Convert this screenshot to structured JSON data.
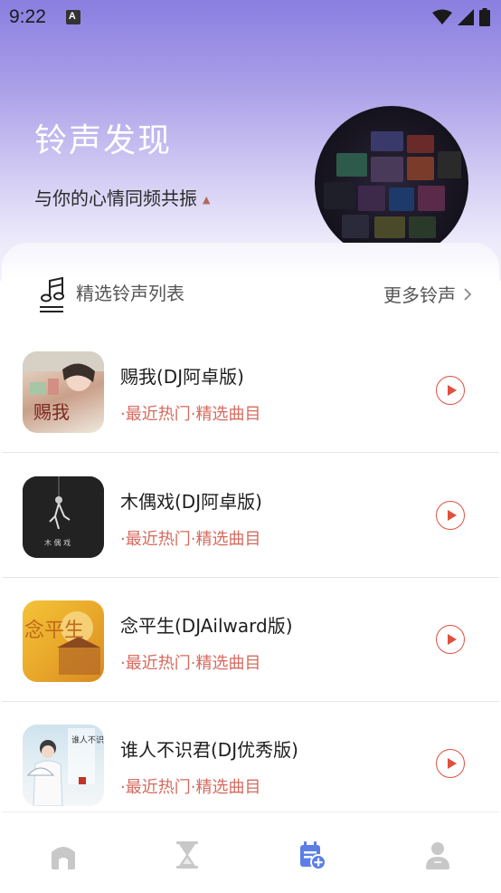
{
  "status_bar": {
    "time": "9:22",
    "notification_icon": "a-icon",
    "icons": [
      "wifi-icon",
      "signal-icon",
      "battery-icon"
    ]
  },
  "hero": {
    "title": "铃声发现",
    "subtitle": "与你的心情同频共振",
    "subtitle_marker": "▲",
    "disc_image": "album-collage"
  },
  "list_header": {
    "title": "精选铃声列表",
    "more_label": "更多铃声",
    "icon": "music-note-icon"
  },
  "songs": [
    {
      "title": "赐我(DJ阿卓版)",
      "tag": "·最近热门·精选曲目",
      "cover_text": "赐我"
    },
    {
      "title": "木偶戏(DJ阿卓版)",
      "tag": "·最近热门·精选曲目",
      "cover_text": "木 偶 戏"
    },
    {
      "title": "念平生(DJAilward版)",
      "tag": "·最近热门·精选曲目",
      "cover_text": "念平生"
    },
    {
      "title": "谁人不识君(DJ优秀版)",
      "tag": "·最近热门·精选曲目",
      "cover_text": "谁人不识君"
    }
  ],
  "bottom_nav": {
    "items": [
      "home-icon",
      "hourglass-icon",
      "calendar-add-icon",
      "user-icon"
    ],
    "active_index": 2
  },
  "colors": {
    "accent": "#5b7fe6",
    "play": "#e0503f",
    "tag": "#d66a5e",
    "nav_inactive": "#c8c8c8"
  }
}
